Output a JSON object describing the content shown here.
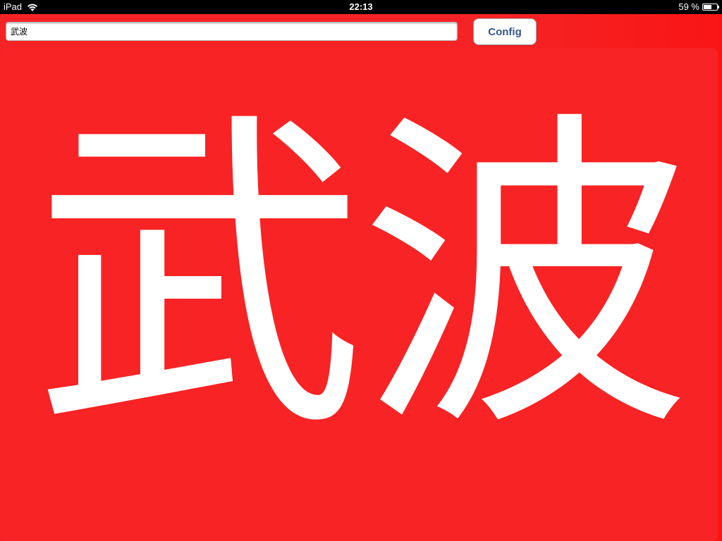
{
  "status_bar": {
    "device": "iPad",
    "time": "22:13",
    "battery_text": "59 %",
    "battery_level": 0.59,
    "wifi_icon": "wifi-icon",
    "battery_icon": "battery-icon"
  },
  "toolbar": {
    "input_value": "武波",
    "config_label": "Config"
  },
  "display": {
    "text": "武波",
    "background_color": "#f82324",
    "text_color": "#ffffff"
  }
}
